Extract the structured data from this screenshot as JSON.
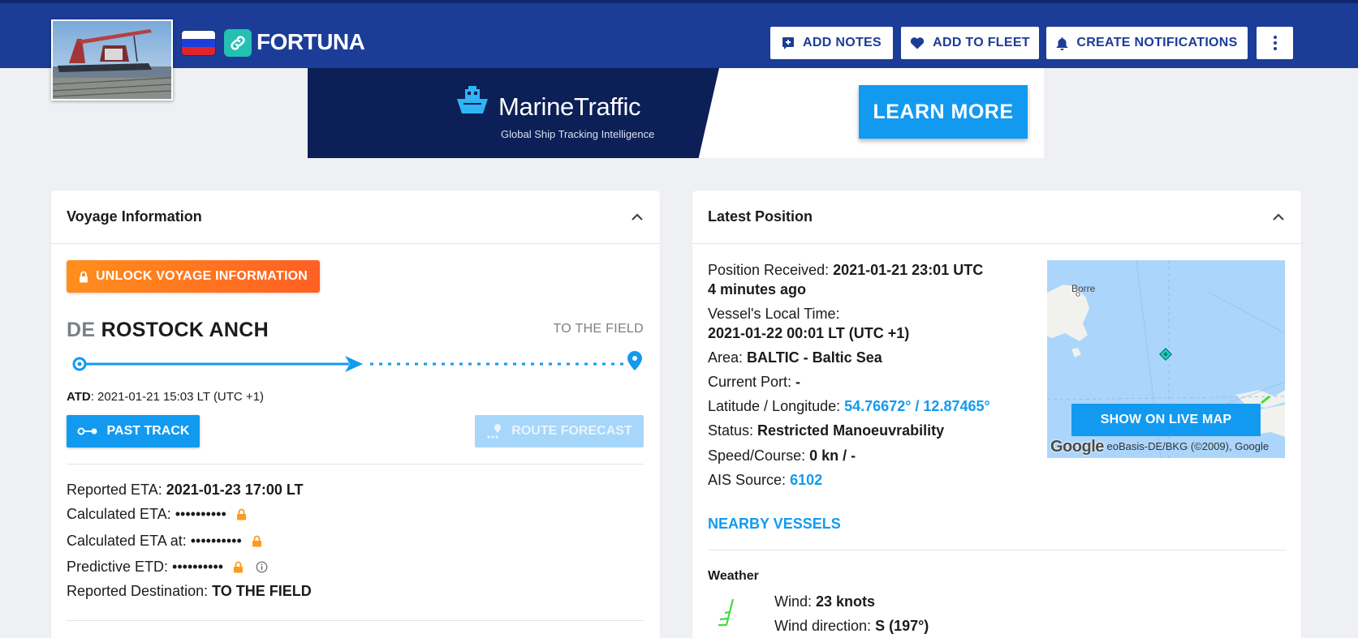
{
  "header": {
    "vessel_name": "FORTUNA",
    "flag_colors": [
      "#ffffff",
      "#1c3fdc",
      "#e0232c"
    ],
    "buttons": {
      "add_notes": "ADD NOTES",
      "add_to_fleet": "ADD TO FLEET",
      "create_notifications": "CREATE NOTIFICATIONS"
    }
  },
  "ad": {
    "brand": "MarineTraffic",
    "tagline": "Global Ship Tracking Intelligence",
    "cta": "LEARN MORE"
  },
  "voyage": {
    "title": "Voyage Information",
    "unlock_label": "UNLOCK VOYAGE INFORMATION",
    "departure_country": "DE",
    "departure_port": "ROSTOCK ANCH",
    "destination_short": "TO THE FIELD",
    "atd_label": "ATD",
    "atd_value": ": 2021-01-21 15:03 LT (UTC +1)",
    "past_track_label": "PAST TRACK",
    "route_forecast_label": "ROUTE FORECAST",
    "reported_eta_label": "Reported ETA: ",
    "reported_eta_value": "2021-01-23 17:00 LT",
    "calculated_eta_label": "Calculated ETA: ",
    "calculated_eta_at_label": "Calculated ETA at: ",
    "predictive_etd_label": "Predictive ETD: ",
    "masked_value": "••••••••••",
    "reported_destination_label": "Reported Destination: ",
    "reported_destination_value": "TO THE FIELD"
  },
  "position": {
    "title": "Latest Position",
    "received_label": "Position Received: ",
    "received_value": "2021-01-21 23:01 UTC",
    "received_ago": "4 minutes ago",
    "local_time_label": "Vessel's Local Time:",
    "local_time_value": "2021-01-22 00:01 LT (UTC +1)",
    "area_label": "Area: ",
    "area_value": "BALTIC - Baltic Sea",
    "current_port_label": "Current Port: ",
    "current_port_value": "-",
    "latlon_label": "Latitude / Longitude: ",
    "latlon_value": "54.76672° / 12.87465°",
    "status_label": "Status: ",
    "status_value": "Restricted Manoeuvrability",
    "speed_label": "Speed/Course: ",
    "speed_value": "0 kn / -",
    "ais_label": "AIS Source: ",
    "ais_value": "6102",
    "nearby_label": "NEARBY VESSELS",
    "map_place": "Borre",
    "map_button": "SHOW ON LIVE MAP",
    "map_google": "Google",
    "map_attribution": "eoBasis-DE/BKG (©2009), Google",
    "weather_title": "Weather",
    "wind_label": "Wind: ",
    "wind_value": "23 knots",
    "wind_dir_label": "Wind direction: ",
    "wind_dir_value": "S (197°)"
  },
  "colors": {
    "header_bg": "#1b3d98",
    "accent_blue": "#129af0",
    "unlock_orange": "#ff7a20",
    "page_bg": "#eef0f3"
  }
}
